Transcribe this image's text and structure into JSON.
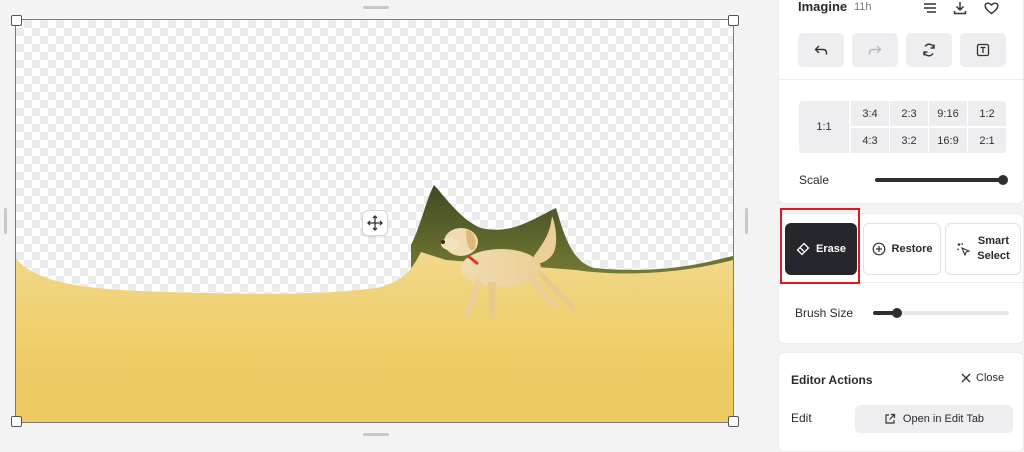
{
  "header": {
    "title": "Imagine",
    "time": "11h"
  },
  "icons": {
    "menu": "menu-lines-icon",
    "download": "download-icon",
    "favorite": "heart-icon",
    "undo": "undo-icon",
    "redo": "redo-icon",
    "regenerate": "refresh-icon",
    "text": "text-box-icon",
    "move": "move-arrows-icon",
    "erase": "eraser-icon",
    "restore": "plus-circle-icon",
    "smart_select": "cursor-sparkle-icon",
    "close": "close-icon",
    "open_external": "external-link-icon"
  },
  "aspect_ratios": {
    "main": "1:1",
    "top_row": [
      "3:4",
      "2:3",
      "9:16",
      "1:2"
    ],
    "bottom_row": [
      "4:3",
      "3:2",
      "16:9",
      "2:1"
    ]
  },
  "scale": {
    "label": "Scale",
    "value": 1.0
  },
  "tools": {
    "erase_label": "Erase",
    "restore_label": "Restore",
    "smart_select_line1": "Smart",
    "smart_select_line2": "Select",
    "active": "Erase"
  },
  "brush": {
    "label": "Brush Size",
    "value": 0.18
  },
  "editor_actions": {
    "title": "Editor Actions",
    "close_label": "Close",
    "edit_label": "Edit",
    "open_button_label": "Open in Edit Tab"
  },
  "colors": {
    "accent_dark": "#26272c",
    "highlight": "#e0181e",
    "field_yellow": "#f3d27a"
  }
}
